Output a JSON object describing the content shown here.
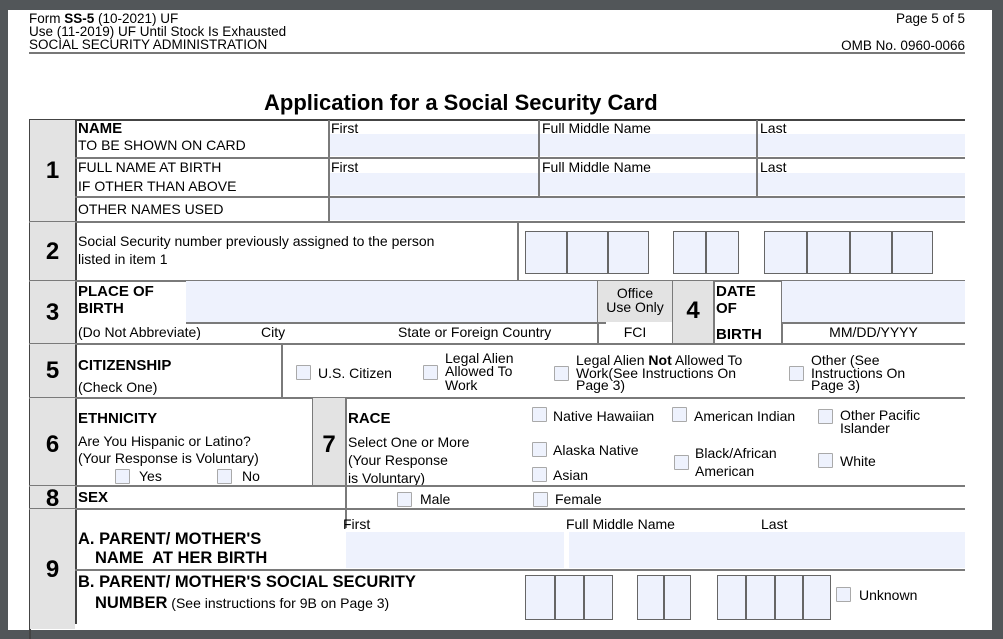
{
  "header": {
    "form_prefix": "Form ",
    "form_id": "SS-5",
    "form_suffix": " (10-2021) UF",
    "use_line": "Use (11-2019) UF Until Stock Is Exhausted",
    "agency": "SOCIAL SECURITY ADMINISTRATION",
    "page_indicator": "Page 5 of 5",
    "omb": "OMB No. 0960-0066",
    "title": "Application for a Social Security Card"
  },
  "item1": {
    "number": "1",
    "name_label": "NAME",
    "name_sub": "TO BE SHOWN ON CARD",
    "birth_label": "FULL NAME AT BIRTH",
    "birth_sub": "IF OTHER THAN ABOVE",
    "other_label": "OTHER NAMES USED",
    "col_first": "First",
    "col_middle": "Full Middle Name",
    "col_last": "Last",
    "fields": {
      "name_first": "",
      "name_middle": "",
      "name_last": "",
      "birth_first": "",
      "birth_middle": "",
      "birth_last": "",
      "other_names": ""
    }
  },
  "item2": {
    "number": "2",
    "label_line1": "Social Security number previously assigned to the person",
    "label_line2": "listed in item 1",
    "ssn_groups": [
      [
        "",
        "",
        ""
      ],
      [
        "",
        ""
      ],
      [
        "",
        "",
        "",
        ""
      ]
    ]
  },
  "item3": {
    "number": "3",
    "label_line1": "PLACE OF",
    "label_line2": "BIRTH",
    "note": "(Do Not Abbreviate)",
    "city_label": "City",
    "state_label": "State or Foreign Country",
    "office_line1": "Office",
    "office_line2": "Use Only",
    "fci_label": "FCI",
    "value": ""
  },
  "item4": {
    "number": "4",
    "label_line1": "DATE",
    "label_line2": "OF",
    "label_line3": "BIRTH",
    "format": "MM/DD/YYYY",
    "value": ""
  },
  "item5": {
    "number": "5",
    "label": "CITIZENSHIP",
    "sub": "(Check One)",
    "options": {
      "us_citizen": "U.S. Citizen",
      "legal_allowed_1": "Legal Alien",
      "legal_allowed_2": "Allowed To",
      "legal_allowed_3": "Work",
      "legal_not_1a": "Legal Alien ",
      "legal_not_1b": "Not",
      "legal_not_1c": " Allowed To",
      "legal_not_2": "Work(See Instructions On",
      "legal_not_3": "Page 3)",
      "other_1": "Other (See",
      "other_2": "Instructions On",
      "other_3": "Page 3)"
    }
  },
  "item6": {
    "number": "6",
    "label": "ETHNICITY",
    "question": "Are You Hispanic or Latino?",
    "voluntary": "(Your Response is Voluntary)",
    "yes": "Yes",
    "no": "No"
  },
  "item7": {
    "number": "7",
    "label": "RACE",
    "sub1": "Select One or More",
    "sub2": "(Your Response",
    "sub3": "is Voluntary)",
    "options": {
      "native_hawaiian": "Native Hawaiian",
      "american_indian": "American Indian",
      "other_pacific_1": "Other Pacific",
      "other_pacific_2": "Islander",
      "alaska_native": "Alaska Native",
      "black_1": "Black/African",
      "black_2": "American",
      "white": "White",
      "asian": "Asian"
    }
  },
  "item8": {
    "number": "8",
    "label": "SEX",
    "male": "Male",
    "female": "Female"
  },
  "item9": {
    "number": "9",
    "a_line1": "A. PARENT/ MOTHER'S",
    "a_line2": "NAME  AT HER BIRTH",
    "col_first": "First",
    "col_middle": "Full Middle Name",
    "col_last": "Last",
    "b_line1": "B. PARENT/ MOTHER'S SOCIAL SECURITY",
    "b_line2_bold": "NUMBER",
    "b_line2_rest": " (See instructions for 9B on Page 3)",
    "unknown": "Unknown",
    "fields": {
      "first": "",
      "middle": "",
      "last": ""
    },
    "ssn_groups": [
      [
        "",
        "",
        ""
      ],
      [
        "",
        ""
      ],
      [
        "",
        "",
        "",
        ""
      ]
    ]
  },
  "colors": {
    "field_fill": "#eef2fd",
    "number_cell": "#e3e3e3",
    "viewer_background": "#525659"
  }
}
